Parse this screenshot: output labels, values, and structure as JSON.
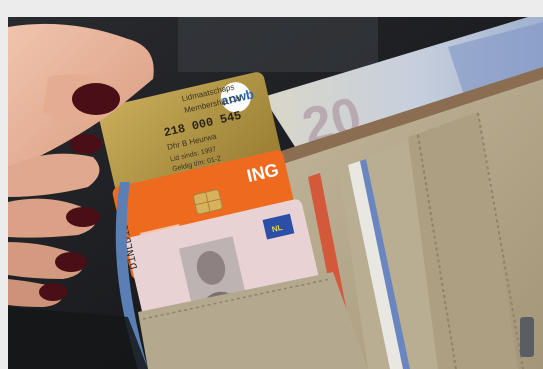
{
  "photo": {
    "anwb_card": {
      "logo_text": "anwb",
      "lines": [
        "Lidmaatschaps",
        "Membership Car",
        "218 000 545",
        "Dhr B Heurwa",
        "Lid sinds: 1997",
        "Geldig t/m: 01-2"
      ]
    },
    "ing_card": {
      "brand": "ING"
    },
    "license": {
      "number": "D1NLD1589",
      "country": "NL"
    },
    "banknote": {
      "denomination": "20"
    }
  },
  "colors": {
    "background": "#ececec",
    "car_interior": "#1b1c1f",
    "wallet_canvas": "#b3a78c",
    "wallet_trim": "#8a7a62",
    "blue_zipper": "#5a7fb4",
    "anwb_gold": "#b89a46",
    "ing_orange": "#ee6a1f",
    "license_pink": "#e8d2d4",
    "nail_polish": "#4a0f16",
    "skin": "#e7b49a"
  }
}
